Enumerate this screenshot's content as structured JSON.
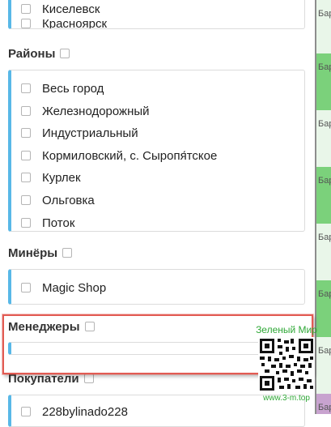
{
  "background_strip": {
    "rows": [
      "Бар",
      "Бар",
      "Бар",
      "Бар",
      "Бар",
      "Бар",
      "Бар",
      "Бар"
    ],
    "colors": {
      "light": "#e9f6e9",
      "green": "#7bd17b",
      "purple": "#c8a3cf"
    }
  },
  "top_cities": {
    "items": [
      "Киселевск",
      "Красноярск"
    ]
  },
  "districts": {
    "title": "Районы",
    "items": [
      "Весь город",
      "Железнодорожный",
      "Индустриальный",
      "Кормиловский, с. Сыропя́тское",
      "Курлек",
      "Ольговка",
      "Поток"
    ]
  },
  "miners": {
    "title": "Минёры",
    "items": [
      "Magic Shop"
    ]
  },
  "managers": {
    "title": "Менеджеры"
  },
  "buyers": {
    "title": "Покупатели",
    "items": [
      "228bylinado228"
    ]
  },
  "watermark": {
    "title": "Зеленый Мир",
    "url": "www.3-m.top"
  },
  "colors": {
    "accent": "#58b8e7",
    "highlight": "#e25b53",
    "watermark": "#2ea836"
  }
}
